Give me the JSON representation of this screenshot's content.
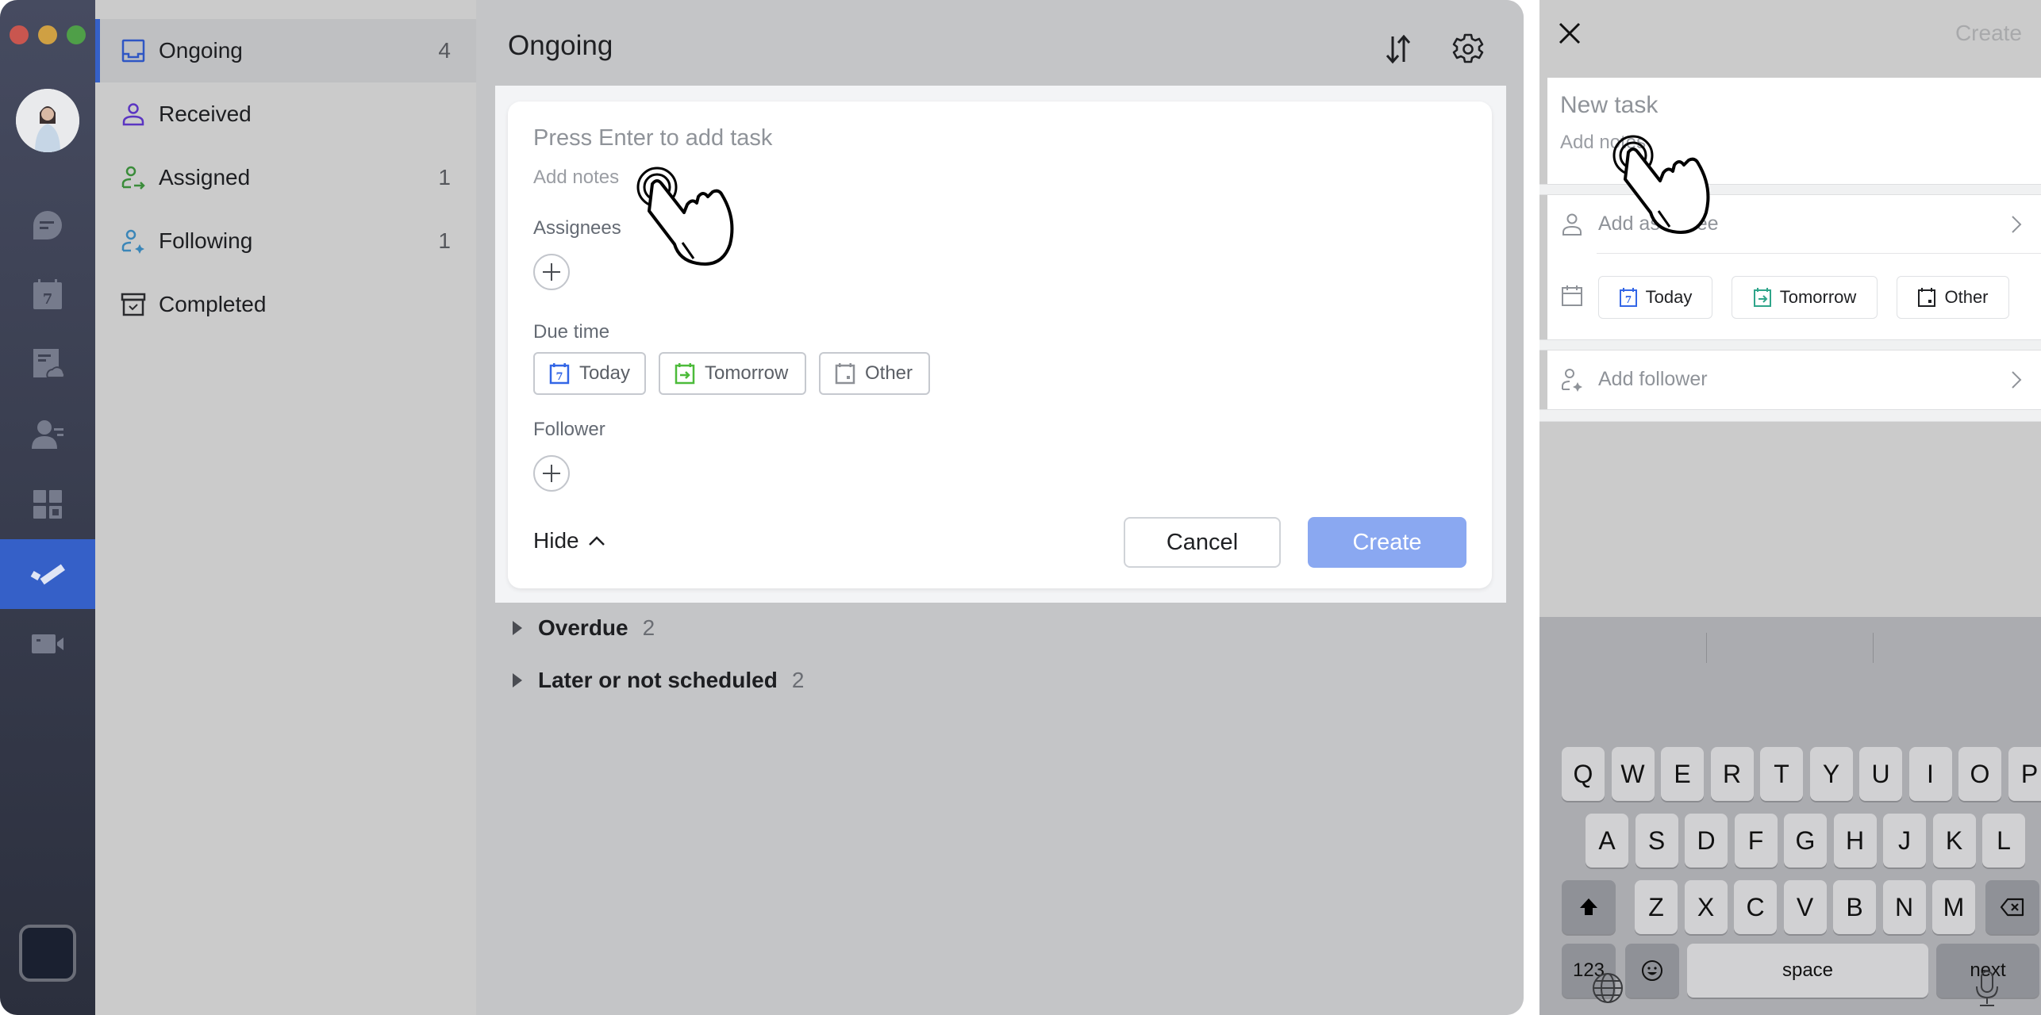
{
  "desktop": {
    "rail": {
      "items": [
        {
          "icon": "chat-icon",
          "label": "Messenger"
        },
        {
          "icon": "calendar-icon",
          "label": "Calendar",
          "day": "7"
        },
        {
          "icon": "docs-cloud-icon",
          "label": "Docs"
        },
        {
          "icon": "contacts-icon",
          "label": "Contacts"
        },
        {
          "icon": "workplace-icon",
          "label": "Workplace"
        },
        {
          "icon": "tasks-icon",
          "label": "Tasks",
          "active": true
        },
        {
          "icon": "video-meeting-icon",
          "label": "Meetings"
        }
      ],
      "accent": "#3560c8"
    },
    "list": {
      "items": [
        {
          "label": "Ongoing",
          "count": "4",
          "icon": "inbox-icon",
          "color": "#2f56c4",
          "active": true
        },
        {
          "label": "Received",
          "count": "",
          "icon": "person-icon",
          "color": "#5b35c2"
        },
        {
          "label": "Assigned",
          "count": "1",
          "icon": "person-assign-icon",
          "color": "#3a8c3a"
        },
        {
          "label": "Following",
          "count": "1",
          "icon": "person-follow-icon",
          "color": "#3b86b8"
        },
        {
          "label": "Completed",
          "count": "",
          "icon": "archive-icon",
          "color": "#2a2b2e"
        }
      ]
    },
    "main": {
      "title": "Ongoing",
      "form": {
        "title_placeholder": "Press Enter to add task",
        "notes_placeholder": "Add notes",
        "assignees_label": "Assignees",
        "due_label": "Due time",
        "due_options": [
          {
            "label": "Today",
            "icon": "calendar-today-icon",
            "color": "#3366e6",
            "day": "7"
          },
          {
            "label": "Tomorrow",
            "icon": "calendar-tomorrow-icon",
            "color": "#4cbb3a"
          },
          {
            "label": "Other",
            "icon": "calendar-other-icon",
            "color": "#8d9096"
          }
        ],
        "follower_label": "Follower",
        "hide_label": "Hide",
        "cancel_label": "Cancel",
        "create_label": "Create",
        "create_color": "#8aa8f1"
      },
      "groups": [
        {
          "label": "Overdue",
          "count": "2"
        },
        {
          "label": "Later or not scheduled",
          "count": "2"
        }
      ]
    }
  },
  "mobile": {
    "create_label": "Create",
    "title_placeholder": "New task",
    "notes_placeholder": "Add notes",
    "assignee_label": "Add assignee",
    "due_options": [
      {
        "label": "Today",
        "icon": "calendar-today-icon",
        "color": "#3366e6",
        "day": "7"
      },
      {
        "label": "Tomorrow",
        "icon": "calendar-tomorrow-icon",
        "color": "#2fa58a"
      },
      {
        "label": "Other",
        "icon": "calendar-other-icon",
        "color": "#1f2023"
      }
    ],
    "follower_label": "Add follower",
    "keyboard": {
      "row1": [
        "Q",
        "W",
        "E",
        "R",
        "T",
        "Y",
        "U",
        "I",
        "O",
        "P"
      ],
      "row2": [
        "A",
        "S",
        "D",
        "F",
        "G",
        "H",
        "J",
        "K",
        "L"
      ],
      "row3": [
        "Z",
        "X",
        "C",
        "V",
        "B",
        "N",
        "M"
      ],
      "numbers_label": "123",
      "space_label": "space",
      "next_label": "next"
    }
  }
}
